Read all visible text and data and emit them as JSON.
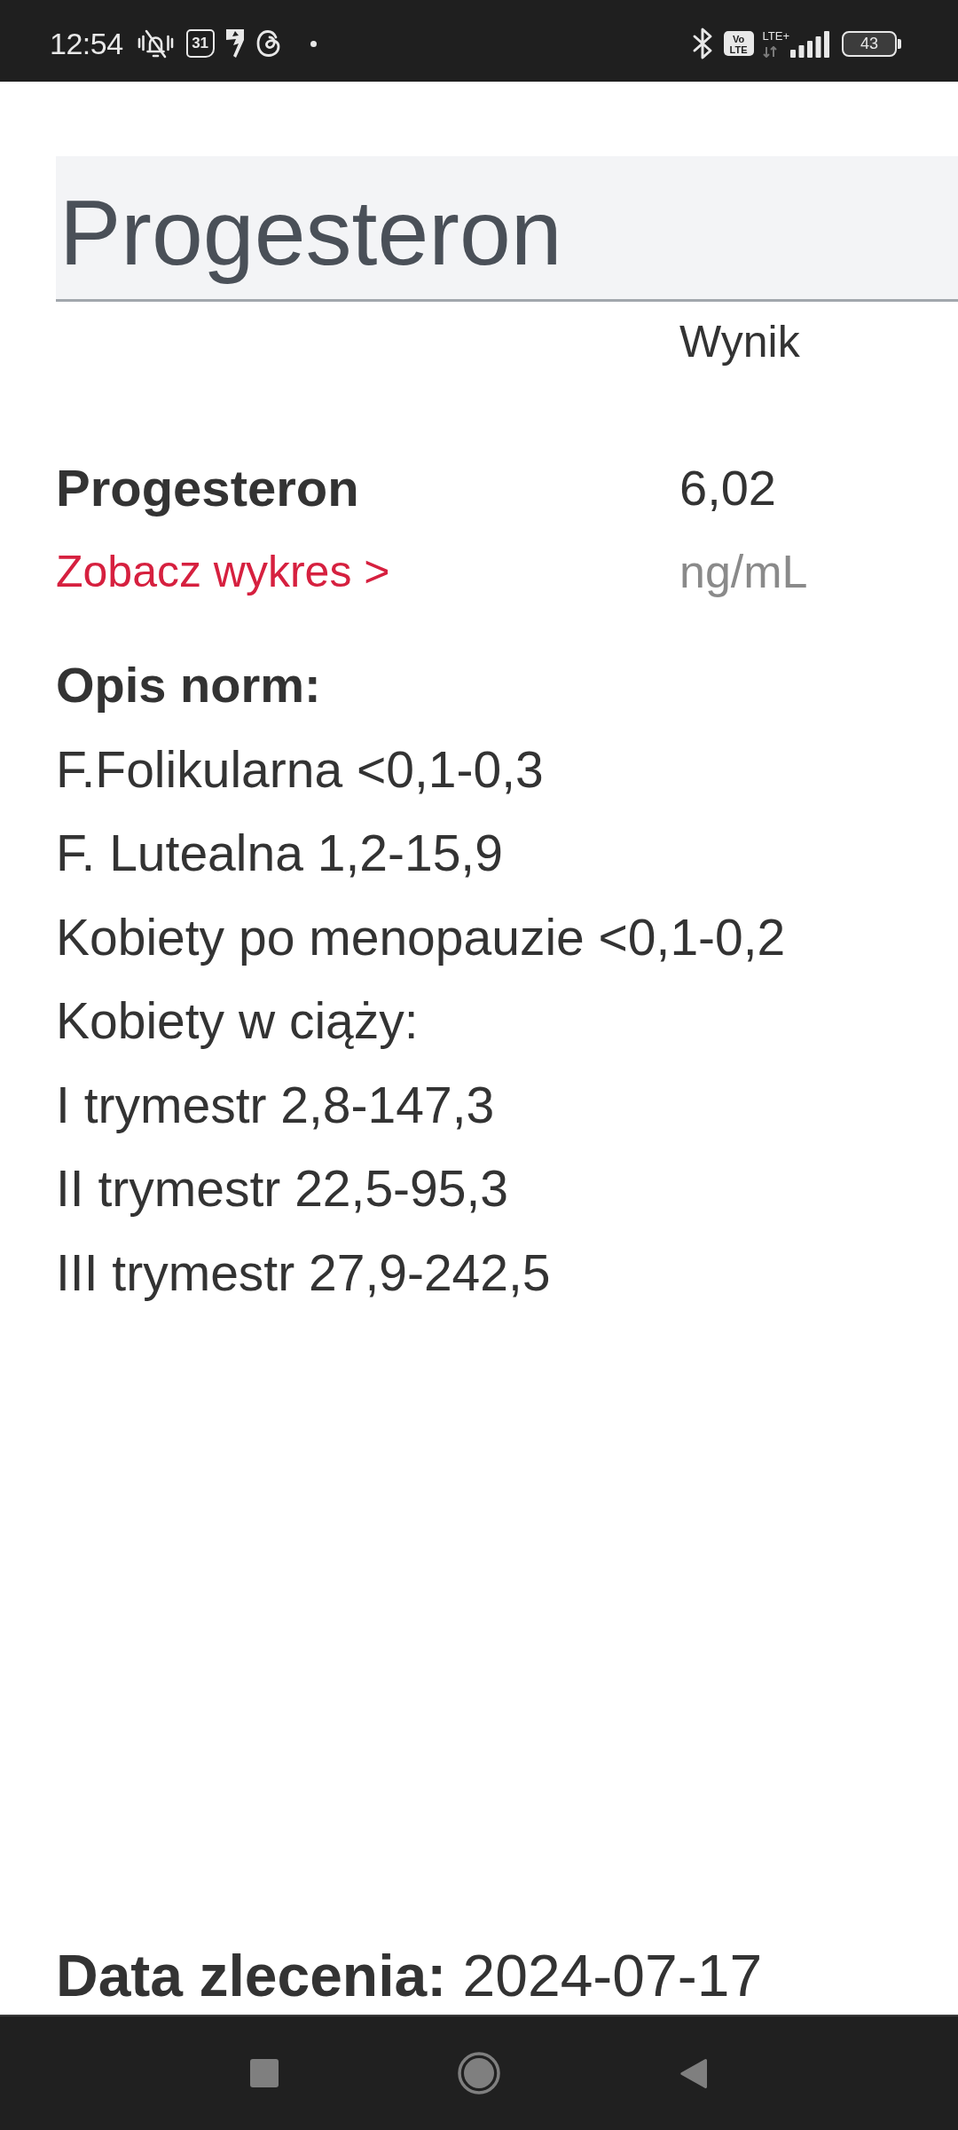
{
  "status_bar": {
    "time": "12:54",
    "calendar_day": "31",
    "volte": "Vo LTE",
    "network_type": "LTE+",
    "battery": "43"
  },
  "header": {
    "title": "Progesteron"
  },
  "results_table": {
    "value_column": "Wynik",
    "rows": [
      {
        "name": "Progesteron",
        "value": "6,02",
        "chart_link": "Zobacz wykres >",
        "unit": "ng/mL"
      }
    ]
  },
  "reference_ranges": {
    "heading": "Opis norm:",
    "lines": [
      "F.Folikularna <0,1-0,3",
      "F. Lutealna 1,2-15,9",
      "Kobiety po menopauzie <0,1-0,2",
      "Kobiety w ciąży:",
      "I trymestr 2,8-147,3",
      "II trymestr 22,5-95,3",
      "III trymestr 27,9-242,5"
    ]
  },
  "order_date": "**Data zlecenia:** 2024-07-17"
}
